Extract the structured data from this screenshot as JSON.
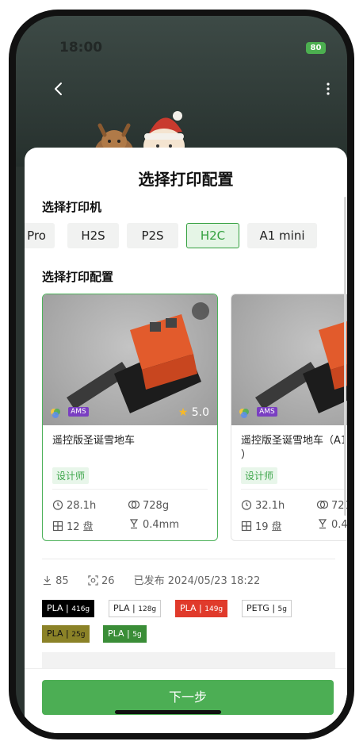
{
  "status_bar": {
    "time": "18:00",
    "battery": "80"
  },
  "sheet": {
    "title": "选择打印配置",
    "printer_section_label": "选择打印机",
    "printers": [
      {
        "label": "Pro",
        "active": false
      },
      {
        "label": "H2S",
        "active": false
      },
      {
        "label": "P2S",
        "active": false
      },
      {
        "label": "H2C",
        "active": true
      },
      {
        "label": "A1 mini",
        "active": false
      }
    ],
    "config_section_label": "选择打印配置",
    "profiles": [
      {
        "title": "遥控版圣诞雪地车",
        "badge": "AMS",
        "rating": "5.0",
        "designer_tag": "设计师",
        "time": "28.1h",
        "weight": "728g",
        "plates": "12 盘",
        "nozzle": "0.4mm"
      },
      {
        "title": "遥控版圣诞雪地车（A1m\n）",
        "badge": "AMS",
        "designer_tag": "设计师",
        "time": "32.1h",
        "weight": "721",
        "plates": "19 盘",
        "nozzle": "0.4"
      }
    ],
    "meta": {
      "downloads": "85",
      "prints": "26",
      "published": "已发布 2024/05/23 18:22"
    },
    "filaments": [
      {
        "type": "PLA",
        "weight": "416g",
        "bg": "#000000",
        "fg": "#ffffff"
      },
      {
        "type": "PLA",
        "weight": "128g",
        "bg": "#ffffff",
        "fg": "#222222"
      },
      {
        "type": "PLA",
        "weight": "149g",
        "bg": "#e03a2b",
        "fg": "#ffffff"
      },
      {
        "type": "PETG",
        "weight": "5g",
        "bg": "#ffffff",
        "fg": "#222222"
      },
      {
        "type": "PLA",
        "weight": "25g",
        "bg": "#8b8227",
        "fg": "#111111"
      },
      {
        "type": "PLA",
        "weight": "5g",
        "bg": "#3a8d37",
        "fg": "#ffffff"
      }
    ],
    "next_button": "下一步"
  },
  "colors": {
    "accent": "#4cae54"
  }
}
